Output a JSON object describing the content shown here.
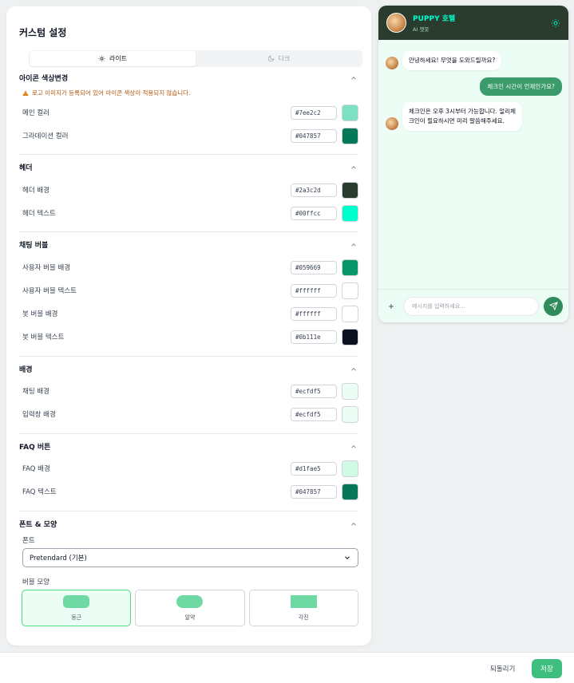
{
  "panel": {
    "title": "커스텀 설정",
    "mode": {
      "light_label": "라이트",
      "dark_label": "다크",
      "selected": "light"
    },
    "sections": {
      "icon": {
        "title": "아이콘 색상변경",
        "warning": "로고 이미지가 등록되어 있어 아이콘 색상이 적용되지 않습니다.",
        "rows": [
          {
            "label": "메인 컬러",
            "hex": "#7ee2c2"
          },
          {
            "label": "그라데이션 컬러",
            "hex": "#047857"
          }
        ]
      },
      "header": {
        "title": "헤더",
        "rows": [
          {
            "label": "헤더 배경",
            "hex": "#2a3c2d"
          },
          {
            "label": "헤더 텍스트",
            "hex": "#00ffcc"
          }
        ]
      },
      "bubble": {
        "title": "채팅 버블",
        "rows": [
          {
            "label": "사용자 버블 배경",
            "hex": "#059669"
          },
          {
            "label": "사용자 버블 텍스트",
            "hex": "#ffffff"
          },
          {
            "label": "봇 버블 배경",
            "hex": "#ffffff"
          },
          {
            "label": "봇 버블 텍스트",
            "hex": "#0b111e"
          }
        ]
      },
      "background": {
        "title": "배경",
        "rows": [
          {
            "label": "채팅 배경",
            "hex": "#ecfdf5"
          },
          {
            "label": "입력창 배경",
            "hex": "#ecfdf5"
          }
        ]
      },
      "faq": {
        "title": "FAQ 버튼",
        "rows": [
          {
            "label": "FAQ 배경",
            "hex": "#d1fae5"
          },
          {
            "label": "FAQ 텍스트",
            "hex": "#047857"
          }
        ]
      },
      "font": {
        "title": "폰트 & 모양",
        "font_label": "폰트",
        "font_value": "Pretendard (기본)",
        "shape_label": "버블 모양",
        "shapes": [
          {
            "name": "둥근",
            "selected": true
          },
          {
            "name": "알약",
            "selected": false
          },
          {
            "name": "각진",
            "selected": false
          }
        ]
      }
    }
  },
  "preview": {
    "title": "PUPPY 호텔",
    "subtitle": "AI 챗봇",
    "messages": [
      {
        "from": "bot",
        "text": "안녕하세요! 무엇을 도와드릴까요?"
      },
      {
        "from": "user",
        "text": "체크인 시간이 언제인가요?"
      },
      {
        "from": "bot",
        "text_line1": "체크인은 오후 3시부터 가능합니다. 얼리체",
        "text_line2": "크인이 필요하시면 미리 말씀해주세요."
      }
    ],
    "input_placeholder": "메시지를 입력하세요..."
  },
  "footer": {
    "reset_label": "되돌리기",
    "save_label": "저장"
  },
  "icons": [
    "sun-icon",
    "moon-icon",
    "warning-icon",
    "chevron-up-icon",
    "chevron-down-icon",
    "plus-icon",
    "send-icon"
  ]
}
